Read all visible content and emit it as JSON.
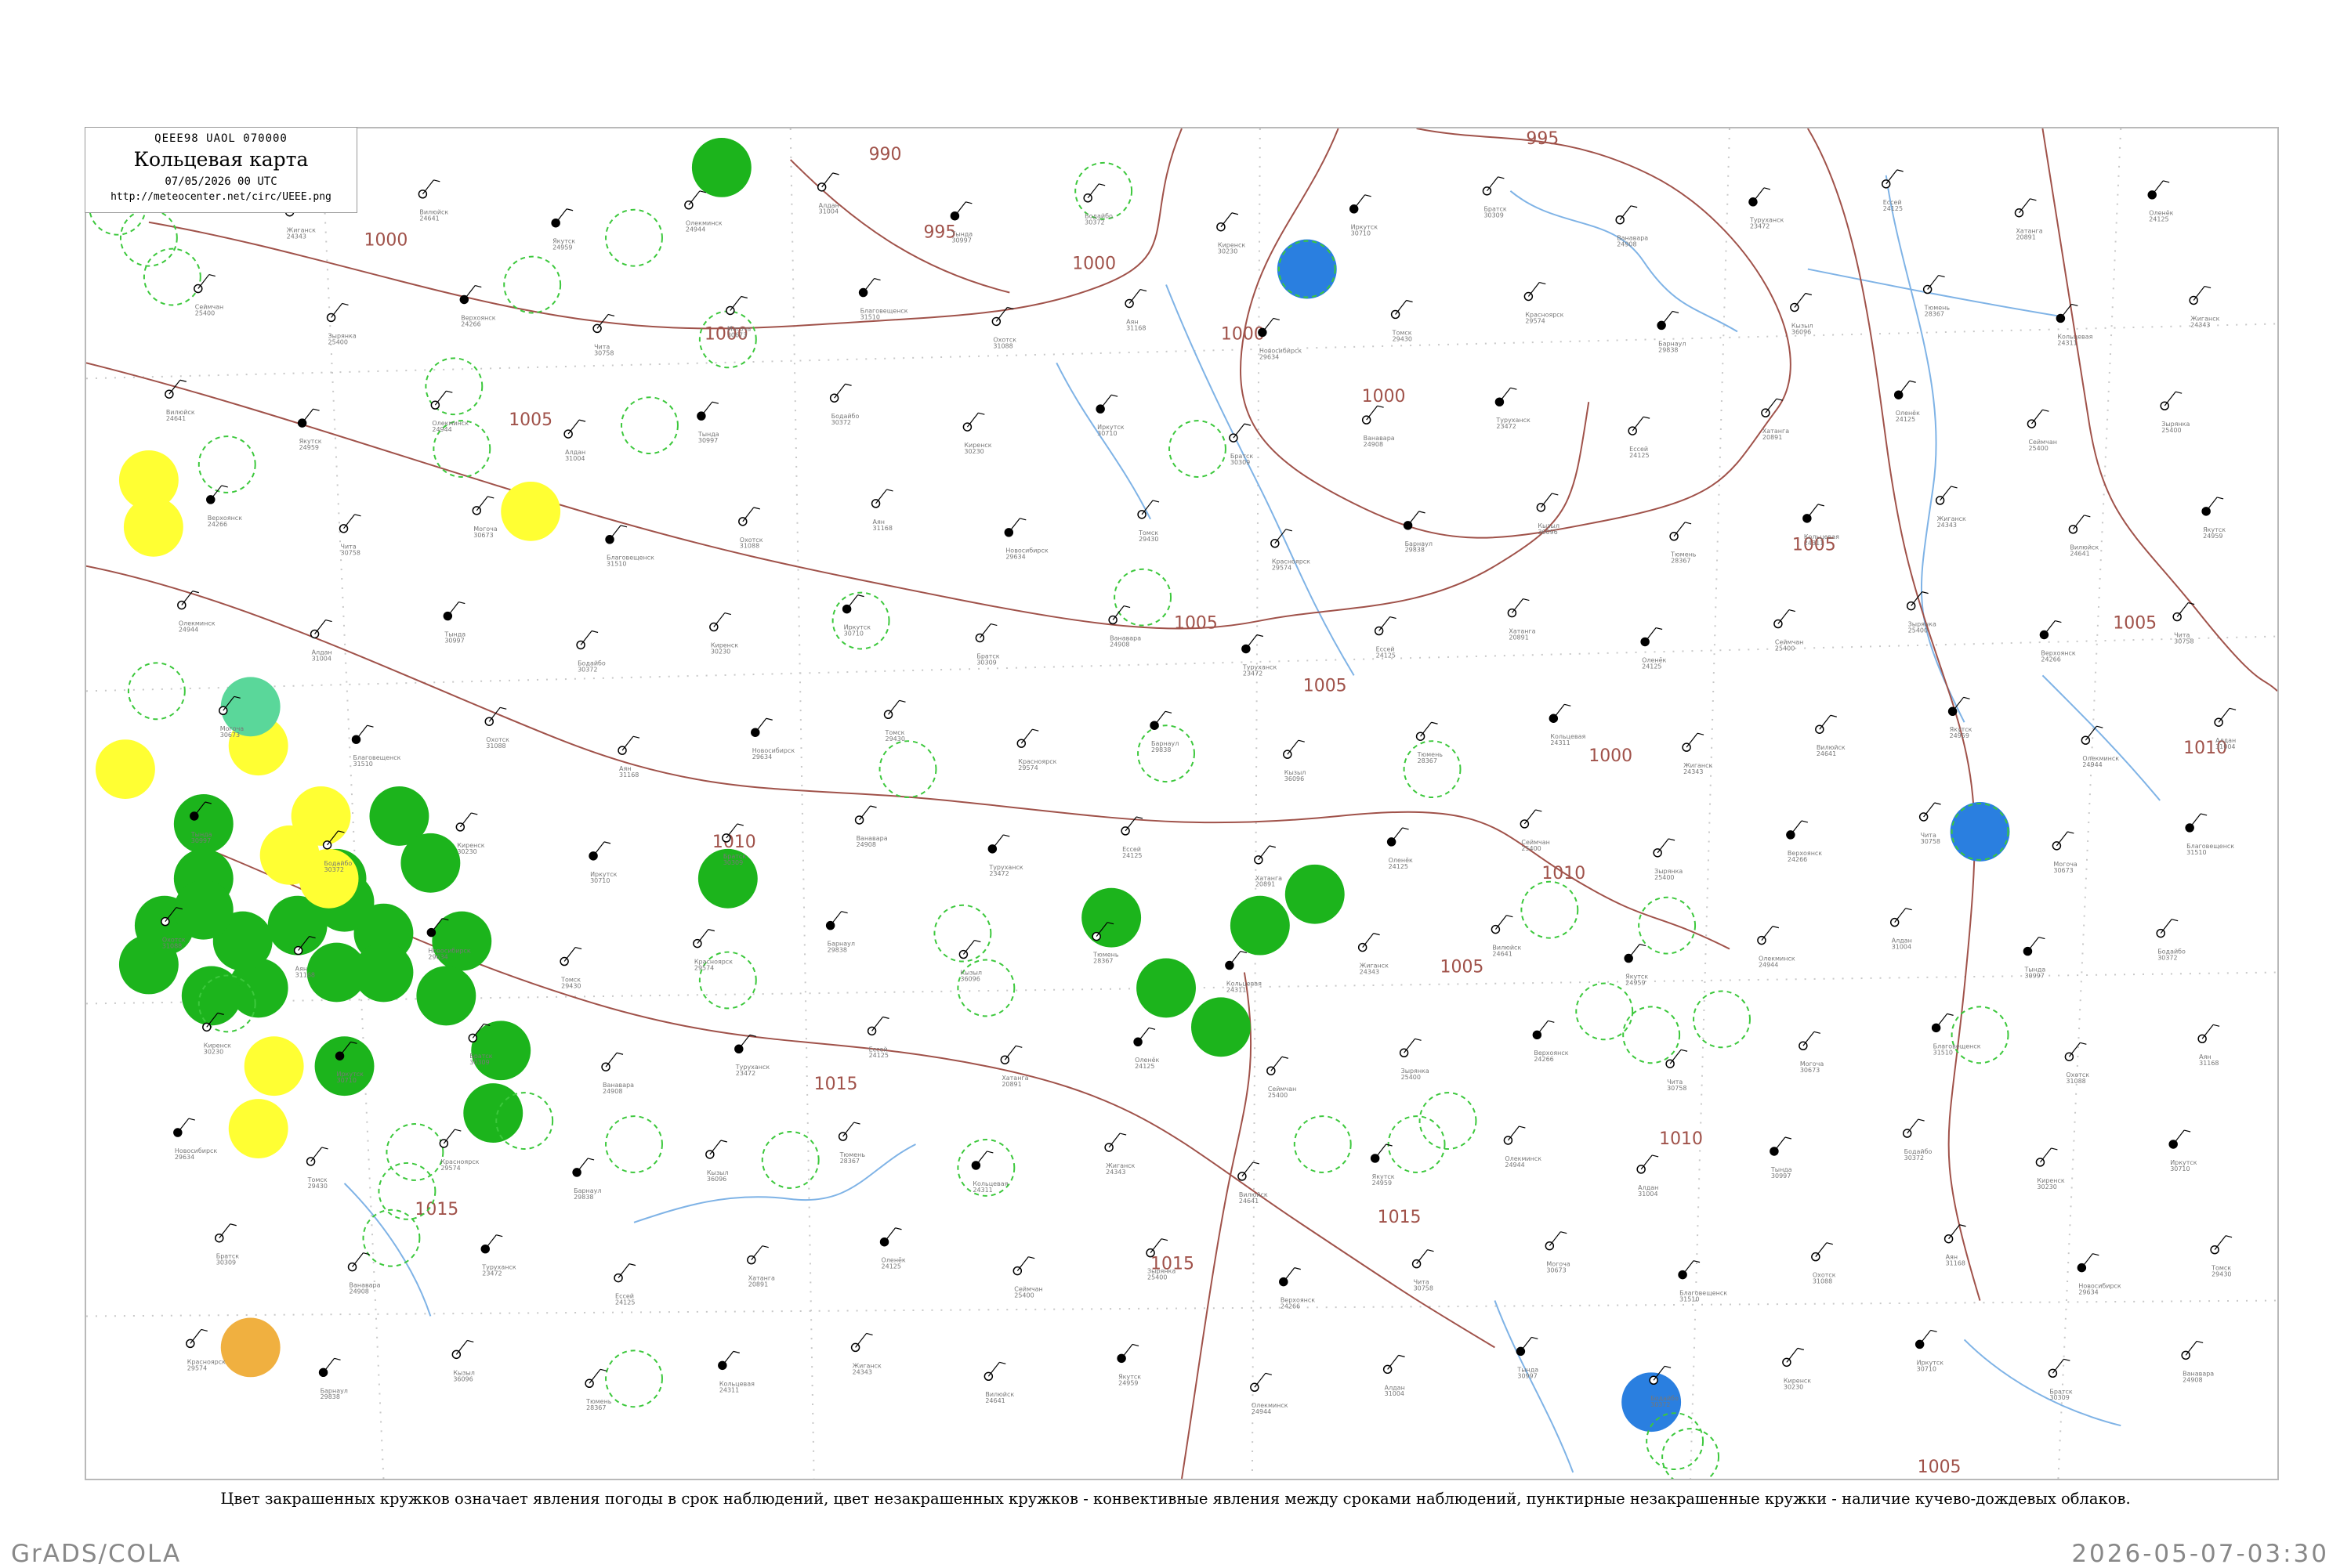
{
  "header": {
    "code": "QEEE98 UAOL 070000",
    "title": "Кольцевая карта",
    "date": "07/05/2026 00 UTC",
    "url": "http://meteocenter.net/circ/UEEE.png"
  },
  "caption": "Цвет закрашенных кружков означает явления погоды в срок наблюдений, цвет незакрашенных кружков - конвективные явления между сроками наблюдений, пунктирные незакрашенные кружки - наличие кучево-дождевых облаков.",
  "footer": {
    "left": "GrADS/COLA",
    "right": "2026-05-07-03:30"
  },
  "colors": {
    "isobar": "#a0524a",
    "river": "#7fb3e6",
    "dotted_grid": "#c8c8c8",
    "green": "#1cb41c",
    "yellow": "#ffff33",
    "blue": "#2a7fe0",
    "orange": "#f0b040",
    "teal": "#5ad79a",
    "dashed_green": "#3cc83c"
  },
  "isobar_labels": [
    "990",
    "995",
    "1000",
    "1000",
    "1000",
    "1000",
    "1005",
    "1005",
    "1005",
    "1005",
    "1005",
    "1010",
    "1010",
    "1010",
    "1010",
    "1015",
    "1015",
    "1015",
    "1015",
    "995",
    "1000",
    "1000",
    "1005",
    "1005"
  ],
  "stations": [
    {
      "name": "Кольцевая",
      "num": "24311"
    },
    {
      "name": "Жиганск",
      "num": "24343"
    },
    {
      "name": "Вилюйск",
      "num": "24641"
    },
    {
      "name": "Якутск",
      "num": "24959"
    },
    {
      "name": "Олекминск",
      "num": "24944"
    },
    {
      "name": "Алдан",
      "num": "31004"
    },
    {
      "name": "Тында",
      "num": "30997"
    },
    {
      "name": "Бодайбо",
      "num": "30372"
    },
    {
      "name": "Киренск",
      "num": "30230"
    },
    {
      "name": "Иркутск",
      "num": "30710"
    },
    {
      "name": "Братск",
      "num": "30309"
    },
    {
      "name": "Ванавара",
      "num": "24908"
    },
    {
      "name": "Туруханск",
      "num": "23472"
    },
    {
      "name": "Ессей",
      "num": "24125"
    },
    {
      "name": "Хатанга",
      "num": "20891"
    },
    {
      "name": "Оленёк",
      "num": "24125"
    },
    {
      "name": "Сеймчан",
      "num": "25400"
    },
    {
      "name": "Зырянка",
      "num": "25400"
    },
    {
      "name": "Верхоянск",
      "num": "24266"
    },
    {
      "name": "Чита",
      "num": "30758"
    },
    {
      "name": "Могоча",
      "num": "30673"
    },
    {
      "name": "Благовещенск",
      "num": "31510"
    },
    {
      "name": "Охотск",
      "num": "31088"
    },
    {
      "name": "Аян",
      "num": "31168"
    },
    {
      "name": "Новосибирск",
      "num": "29634"
    },
    {
      "name": "Томск",
      "num": "29430"
    },
    {
      "name": "Красноярск",
      "num": "29574"
    },
    {
      "name": "Барнаул",
      "num": "29838"
    },
    {
      "name": "Кызыл",
      "num": "36096"
    },
    {
      "name": "Тюмень",
      "num": "28367"
    }
  ]
}
